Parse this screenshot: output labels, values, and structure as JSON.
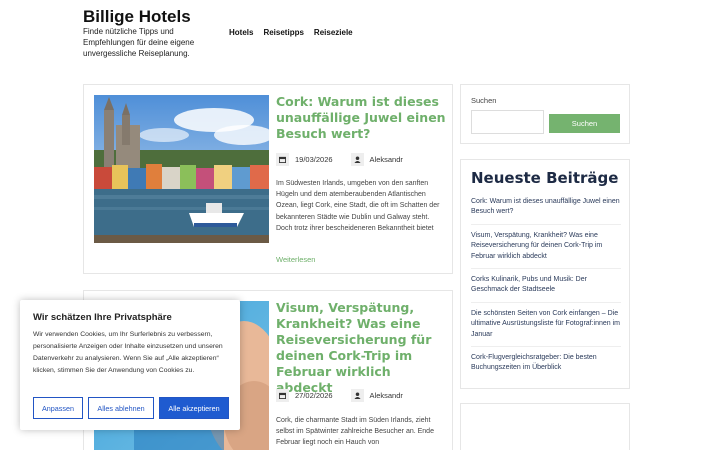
{
  "site": {
    "title": "Billige Hotels",
    "description": "Finde nützliche Tipps und Empfehlungen für deine eigene unvergessliche Reiseplanung."
  },
  "nav": [
    {
      "label": "Hotels"
    },
    {
      "label": "Reisetipps"
    },
    {
      "label": "Reiseziele"
    }
  ],
  "posts": [
    {
      "title": "Cork: Warum ist dieses unauffällige Juwel einen Besuch wert?",
      "date": "19/03/2026",
      "author": "Aleksandr",
      "excerpt": "Im Südwesten Irlands, umgeben von den sanften Hügeln und dem atemberaubenden Atlantischen Ozean, liegt Cork, eine Stadt, die oft im Schatten der bekannteren Städte wie Dublin und Galway steht. Doch trotz ihrer bescheideneren Bekanntheit bietet",
      "read_more": "Weiterlesen"
    },
    {
      "title": "Visum, Verspätung, Krankheit? Was eine Reiseversicherung für deinen Cork-Trip im Februar wirklich abdeckt",
      "date": "27/02/2026",
      "author": "Aleksandr",
      "excerpt": "Cork, die charmante Stadt im Süden Irlands, zieht selbst im Spätwinter zahlreiche Besucher an. Ende Februar liegt noch ein Hauch von"
    }
  ],
  "search": {
    "label": "Suchen",
    "placeholder": "",
    "value": "",
    "button_label": "Suchen"
  },
  "recent": {
    "title": "Neueste Beiträge",
    "items": [
      "Cork: Warum ist dieses unauffällige Juwel einen Besuch wert?",
      "Visum, Verspätung, Krankheit? Was eine Reiseversicherung für deinen Cork-Trip im Februar wirklich abdeckt",
      "Corks Kulinarik, Pubs und Musik: Der Geschmack der Stadtseele",
      "Die schönsten Seiten von Cork einfangen – Die ultimative Ausrüstungsliste für Fotograf:innen im Januar",
      "Cork-Flugvergleichsratgeber: Die besten Buchungszeiten im Überblick"
    ]
  },
  "cookie": {
    "title": "Wir schätzen Ihre Privatsphäre",
    "text": "Wir verwenden Cookies, um Ihr Surferlebnis zu verbessern, personalisierte Anzeigen oder Inhalte einzusetzen und unseren Datenverkehr zu analysieren. Wenn Sie auf „Alle akzeptieren“ klicken, stimmen Sie der Anwendung von Cookies zu.",
    "buttons": {
      "customize": "Anpassen",
      "reject": "Alles ablehnen",
      "accept": "Alle akzeptieren"
    }
  },
  "icons": {
    "date": "calendar-icon",
    "author": "user-icon"
  },
  "colors": {
    "accent_green": "#75b36f",
    "cookie_blue": "#1f5bd0"
  }
}
